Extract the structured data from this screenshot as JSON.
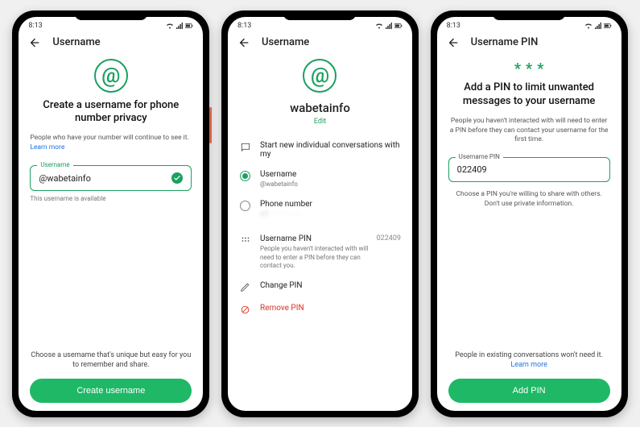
{
  "status": {
    "time": "8:13"
  },
  "screen1": {
    "appbar_title": "Username",
    "heading": "Create a username for phone number privacy",
    "subtext": "People who have your number will continue to see it.",
    "learn_more": "Learn more",
    "field_label": "Username",
    "field_value": "@wabetainfo",
    "hint": "This username is available",
    "foot": "Choose a username that's unique but easy for you to remember and share.",
    "button": "Create username"
  },
  "screen2": {
    "appbar_title": "Username",
    "username": "wabetainfo",
    "edit": "Edit",
    "start_text": "Start new individual conversations with my",
    "opt_username_label": "Username",
    "opt_username_handle": "@wabetainfo",
    "opt_phone_label": "Phone number",
    "opt_phone_value": "+1 ··· ··· ····",
    "pin_row_title": "Username PIN",
    "pin_row_sub": "People you haven't interacted with will need to enter a PIN before they can contact you.",
    "pin_value": "022409",
    "change_pin": "Change PIN",
    "remove_pin": "Remove PIN"
  },
  "screen3": {
    "appbar_title": "Username PIN",
    "heading": "Add a PIN to limit unwanted messages to your username",
    "subtext": "People you haven't interacted with will need to enter a PIN before they can contact your username for the first time.",
    "field_label": "Username PIN",
    "field_value": "022409",
    "below_field": "Choose a PIN you're willing to share with others. Don't use private information.",
    "foot1": "People in existing conversations won't need it.",
    "learn_more": "Learn more",
    "button": "Add PIN"
  },
  "colors": {
    "accent": "#1fb866",
    "outline": "#1ba05f",
    "danger": "#d93025"
  }
}
